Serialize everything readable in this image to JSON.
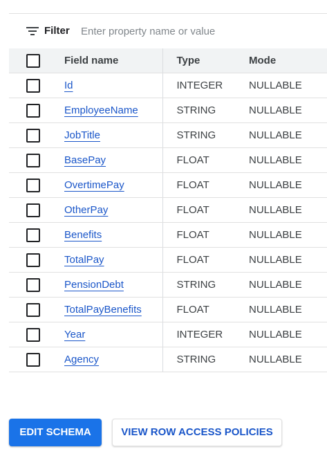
{
  "filter": {
    "label": "Filter",
    "placeholder": "Enter property name or value",
    "value": ""
  },
  "columns": {
    "field_name": "Field name",
    "type": "Type",
    "mode": "Mode"
  },
  "rows": [
    {
      "name": "Id",
      "type": "INTEGER",
      "mode": "NULLABLE"
    },
    {
      "name": "EmployeeName",
      "type": "STRING",
      "mode": "NULLABLE"
    },
    {
      "name": "JobTitle",
      "type": "STRING",
      "mode": "NULLABLE"
    },
    {
      "name": "BasePay",
      "type": "FLOAT",
      "mode": "NULLABLE"
    },
    {
      "name": "OvertimePay",
      "type": "FLOAT",
      "mode": "NULLABLE"
    },
    {
      "name": "OtherPay",
      "type": "FLOAT",
      "mode": "NULLABLE"
    },
    {
      "name": "Benefits",
      "type": "FLOAT",
      "mode": "NULLABLE"
    },
    {
      "name": "TotalPay",
      "type": "FLOAT",
      "mode": "NULLABLE"
    },
    {
      "name": "PensionDebt",
      "type": "STRING",
      "mode": "NULLABLE"
    },
    {
      "name": "TotalPayBenefits",
      "type": "FLOAT",
      "mode": "NULLABLE"
    },
    {
      "name": "Year",
      "type": "INTEGER",
      "mode": "NULLABLE"
    },
    {
      "name": "Agency",
      "type": "STRING",
      "mode": "NULLABLE"
    }
  ],
  "buttons": {
    "edit_schema": "EDIT SCHEMA",
    "view_row_access": "VIEW ROW ACCESS POLICIES"
  },
  "colors": {
    "primary": "#1a73e8",
    "link": "#1a56c9",
    "header_bg": "#f1f3f4"
  },
  "icons": {
    "filter": "filter-icon"
  }
}
